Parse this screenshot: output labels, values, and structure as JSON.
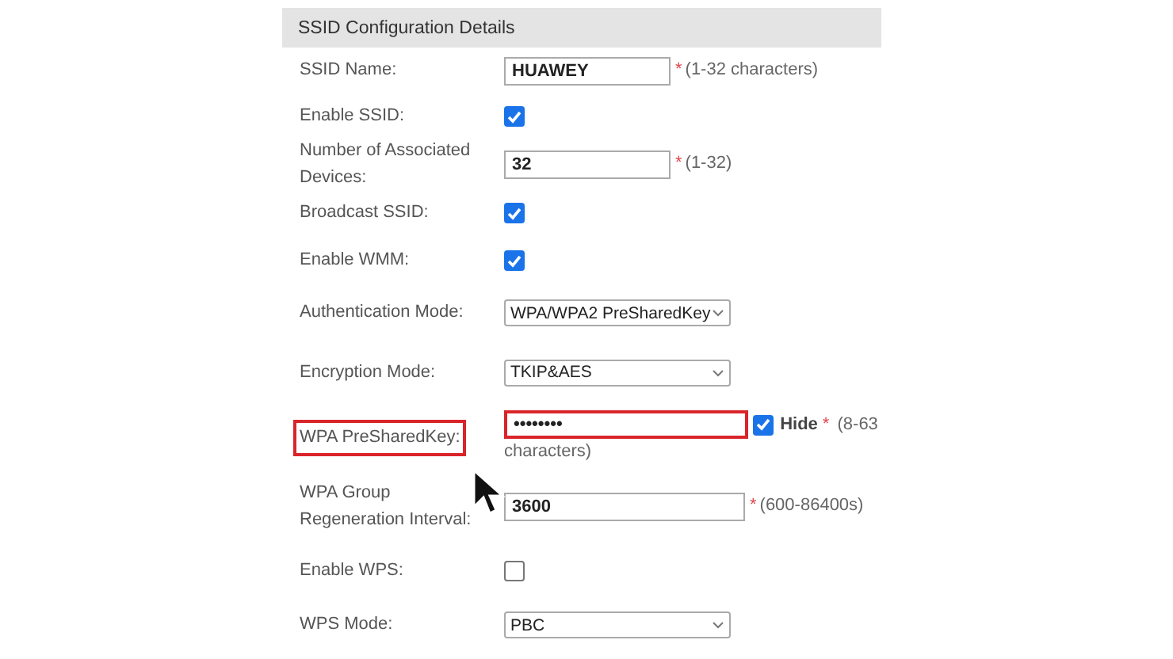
{
  "section": {
    "title": "SSID Configuration Details"
  },
  "rows": [
    {
      "kind": "text",
      "label": "SSID Name:",
      "value": "HUAWEY",
      "mark": "*",
      "hint": "(1-32 characters)",
      "highlighted": false
    },
    {
      "kind": "checkbox",
      "label": "Enable SSID:",
      "checked": true
    },
    {
      "kind": "text",
      "label": "Number of Associated Devices:",
      "value": "32",
      "mark": "*",
      "hint": "(1-32)",
      "highlighted": false
    },
    {
      "kind": "checkbox",
      "label": "Broadcast SSID:",
      "checked": true
    },
    {
      "kind": "checkbox",
      "label": "Enable WMM:",
      "checked": true
    },
    {
      "kind": "select",
      "label": "Authentication Mode:",
      "value": "WPA/WPA2 PreSharedKey"
    },
    {
      "kind": "select",
      "label": "Encryption Mode:",
      "value": "TKIP&AES"
    },
    {
      "kind": "password",
      "label": "WPA PreSharedKey:",
      "value": "••••••••",
      "hide_label": "Hide",
      "hide_checked": true,
      "mark": "*",
      "hint_lines": [
        "(8-63",
        "characters)"
      ],
      "highlighted": true
    },
    {
      "kind": "text",
      "label": "WPA Group Regeneration Interval:",
      "value": "3600",
      "mark": "*",
      "hint": "(600-86400s)",
      "highlighted": false
    },
    {
      "kind": "checkbox",
      "label": "Enable WPS:",
      "checked": false
    },
    {
      "kind": "select",
      "label": "WPS Mode:",
      "value": "PBC"
    }
  ]
}
